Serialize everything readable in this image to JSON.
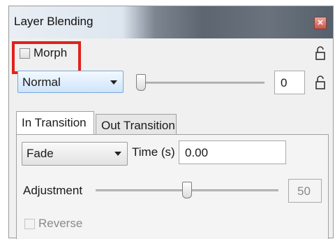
{
  "window": {
    "title": "Layer Blending"
  },
  "morph": {
    "label": "Morph",
    "checked": false,
    "lock_icon": "lock-icon"
  },
  "blend": {
    "mode": "Normal",
    "opacity_value": "0",
    "lock_icon": "lock-icon"
  },
  "tabs": [
    {
      "label": "In Transition",
      "active": true
    },
    {
      "label": "Out Transition",
      "active": false
    }
  ],
  "transition": {
    "type": "Fade",
    "time_label": "Time (s)",
    "time_value": "0.00",
    "adjustment_label": "Adjustment",
    "adjustment_value": "50",
    "reverse_label": "Reverse",
    "reverse_checked": false
  },
  "colors": {
    "highlight": "#e0221b",
    "combo_accent": "#7aa8d4"
  }
}
